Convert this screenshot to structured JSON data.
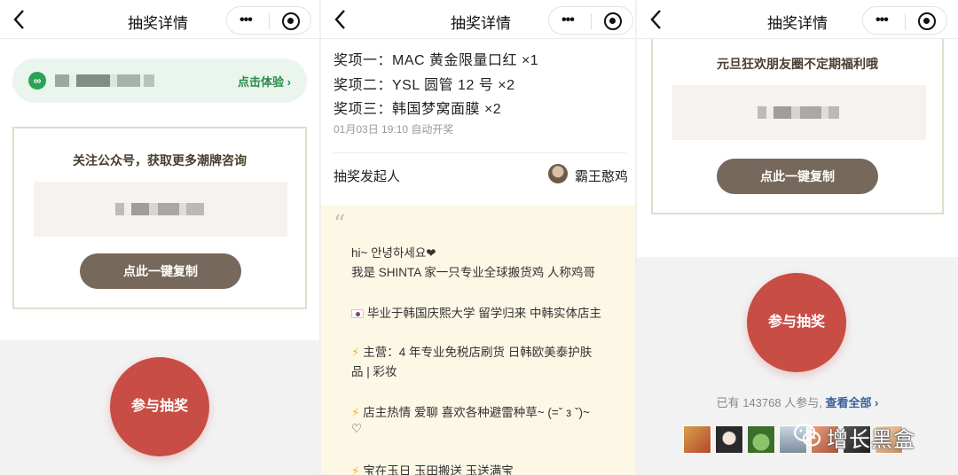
{
  "panel1": {
    "nav": {
      "title": "抽奖详情"
    },
    "mini_program": {
      "link": "点击体验 ›"
    },
    "card": {
      "title": "关注公众号，获取更多潮牌咨询",
      "copy_button": "点此一键复制"
    },
    "join_button": "参与抽奖"
  },
  "panel2": {
    "nav": {
      "title": "抽奖详情"
    },
    "prizes": [
      "奖项一：MAC 黄金限量口红 ×1",
      "奖项二：YSL 圆管 12 号 ×2",
      "奖项三：韩国梦窝面膜 ×2"
    ],
    "draw_time": "01月03日 19:10 自动开奖",
    "sponsor": {
      "label": "抽奖发起人",
      "name": "霸王憨鸡"
    },
    "note": {
      "quote": "“",
      "lines": [
        "hi~ 안녕하세요❤",
        "我是 SHINTA 家一只专业全球搬货鸡  人称鸡哥",
        "毕业于韩国庆熙大学 留学归来 中韩实体店主",
        "主营：4 年专业免税店刷货 日韩欧美泰护肤",
        "品 | 彩妆",
        "店主热情 爱聊  喜欢各种避雷种草~ (=ˇ з ˇ)~",
        "♡",
        "   宝在玉日  玉田搬送  玉送满宝"
      ],
      "bolt": "⚡"
    }
  },
  "panel3": {
    "nav": {
      "title": "抽奖详情"
    },
    "card": {
      "title": "元旦狂欢朋友圈不定期福利哦",
      "copy_button": "点此一键复制"
    },
    "join_button": "参与抽奖",
    "participants": {
      "count_text": "已有 143768 人参与,",
      "view_all": "查看全部 ›"
    },
    "watermark": "增长黑盒"
  },
  "colors": {
    "accent_red": "#c84d44",
    "copy_brown": "#76685a",
    "mini_green": "#2aa356",
    "link_blue": "#3a5f9c"
  }
}
